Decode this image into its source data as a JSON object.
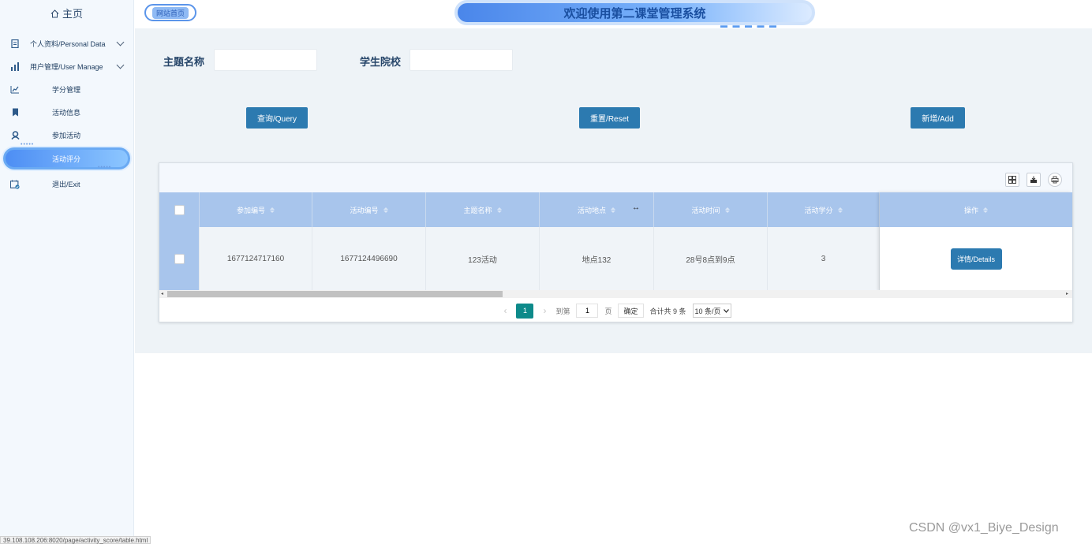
{
  "sidebar": {
    "home_label": "主页",
    "items": [
      {
        "label": "个人资料/Personal Data",
        "icon": "document-icon",
        "expandable": true
      },
      {
        "label": "用户管理/User Manage",
        "icon": "chart-bar-icon",
        "expandable": true
      },
      {
        "label": "学分管理",
        "icon": "chart-line-icon"
      },
      {
        "label": "活动信息",
        "icon": "bookmark-icon"
      },
      {
        "label": "参加活动",
        "icon": "user-badge-icon"
      },
      {
        "label": "活动评分",
        "icon": "",
        "active": true
      },
      {
        "label": "退出/Exit",
        "icon": "calendar-check-icon"
      }
    ]
  },
  "header": {
    "home_link": "网站首页",
    "title": "欢迎使用第二课堂管理系统"
  },
  "search": {
    "topic_label": "主题名称",
    "topic_value": "",
    "school_label": "学生院校",
    "school_value": ""
  },
  "actions": {
    "query": "查询/Query",
    "reset": "重置/Reset",
    "add": "新增/Add"
  },
  "table": {
    "columns": [
      "参加编号",
      "活动编号",
      "主题名称",
      "活动地点",
      "活动时间",
      "活动学分"
    ],
    "op_column": "操作",
    "rows": [
      {
        "cells": [
          "1677124717160",
          "1677124496690",
          "123活动",
          "地点132",
          "28号8点到9点",
          "3"
        ],
        "details": "详情/Details"
      }
    ]
  },
  "pagination": {
    "current_page": "1",
    "goto_label": "到第",
    "goto_value": "1",
    "page_unit": "页",
    "confirm": "确定",
    "total": "合计共 9 条",
    "page_size": "10 条/页"
  },
  "status_url": "39.108.108.206:8020/page/activity_score/table.html",
  "watermark": "CSDN @vx1_Biye_Design",
  "colors": {
    "primary_button": "#2c7ab0",
    "table_header": "#a8c5ec",
    "active_page": "#0d8a8a",
    "banner": "#4a86ea"
  }
}
